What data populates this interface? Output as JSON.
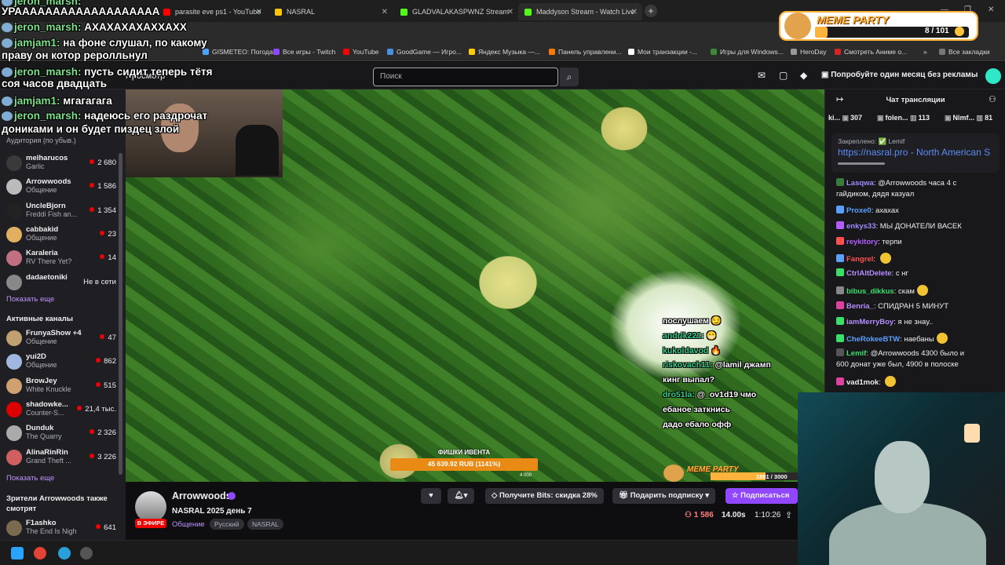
{
  "browser": {
    "tabs": [
      {
        "label": "parasite eve ps1 - YouTube",
        "color": "#ff0000"
      },
      {
        "label": "NASRAL",
        "color": "#ffc400"
      },
      {
        "label": "GLADVALAKASPWNZ Stream",
        "color": "#53fc18"
      },
      {
        "label": "Maddyson Stream - Watch Live",
        "color": "#53fc18"
      }
    ],
    "new_tab": "+",
    "bookmarks": [
      {
        "label": "Все игры - Twitch",
        "color": "#9147ff"
      },
      {
        "label": "YouTube",
        "color": "#ff0000"
      },
      {
        "label": "GoodGame — Игро...",
        "color": "#4a90e2"
      },
      {
        "label": "Яндекс Музыка —...",
        "color": "#ffcc00"
      },
      {
        "label": "Панель управлени...",
        "color": "#ff7a00"
      },
      {
        "label": "Мои транзакции -...",
        "color": "#ffffff"
      },
      {
        "label": "Игры для Windows...",
        "color": "#3a8a3a"
      },
      {
        "label": "HeroDay",
        "color": "#999999"
      },
      {
        "label": "Смотреть Аниме о...",
        "color": "#d62424"
      }
    ],
    "bookmarks_all": "Все закладки",
    "partial_bookmark": "GISMETEO: Погода...",
    "partial_bookmark2": "Ми...Ру почта,..."
  },
  "twitch": {
    "search_placeholder": "Поиск",
    "browse": "Просмотр",
    "promo": "Попробуйте один месяц без рекламы"
  },
  "sidebar": {
    "audience_header": "Аудитория (по убыв.)",
    "audience": [
      {
        "name": "melharucos",
        "sub": "Garlic",
        "count": "2 680",
        "color": "#3a3a3a"
      },
      {
        "name": "Arrowwoods",
        "sub": "Общение",
        "count": "1 586",
        "color": "#bbbbbb"
      },
      {
        "name": "UncleBjorn",
        "sub": "Freddi Fish an...",
        "count": "1 354",
        "color": "#222222"
      },
      {
        "name": "cabbakid",
        "sub": "Общение",
        "count": "23",
        "color": "#e0b060"
      },
      {
        "name": "Karaleria",
        "sub": "RV There Yet?",
        "count": "14",
        "color": "#c07080"
      },
      {
        "name": "dadaetoniki",
        "sub": "",
        "count": "Не в сети",
        "color": "#888888"
      }
    ],
    "show_more": "Показать еще",
    "active_header": "Активные каналы",
    "active": [
      {
        "name": "FrunyaShow +4",
        "sub": "Общение",
        "count": "47",
        "color": "#c0a070"
      },
      {
        "name": "yui2D",
        "sub": "Общение",
        "count": "862",
        "color": "#a0b8e0"
      },
      {
        "name": "BrowJey",
        "sub": "White Knuckle",
        "count": "515",
        "color": "#d0a070"
      },
      {
        "name": "shadowke...",
        "sub": "Counter-S...",
        "count": "21,4 тыс.",
        "color": "#dd0000"
      },
      {
        "name": "Dunduk",
        "sub": "The Quarry",
        "count": "2 326",
        "color": "#aaaaaa"
      },
      {
        "name": "AlinaRinRin",
        "sub": "Grand Theft ...",
        "count": "3 226",
        "color": "#d06060"
      }
    ],
    "show_more2": "Показать еще",
    "also_header": "Зрители Arrowwoods также смотрят",
    "also": [
      {
        "name": "F1ashko",
        "sub": "The End Is Nigh",
        "count": "641",
        "color": "#7a6a50"
      }
    ]
  },
  "overlay_chat": [
    {
      "user": "jeron_marsh:",
      "text": ""
    },
    {
      "user": "",
      "text": "УРААААААААААААААААААА"
    },
    {
      "user": "jeron_marsh:",
      "text": "АХАХАХАХАХХАХХ"
    },
    {
      "user": "jamjam1:",
      "text": "на фоне слушал, по какому"
    },
    {
      "user": "",
      "text": "праву он котор реролльнул"
    },
    {
      "user": "jeron_marsh:",
      "text": "пусть сидит теперь тётя"
    },
    {
      "user": "",
      "text": "соя часов двадцать"
    },
    {
      "user": "jamjam1:",
      "text": "мгагагага"
    },
    {
      "user": "jeron_marsh:",
      "text": "надеюсь его раздрочат"
    },
    {
      "user": "",
      "text": "дониками и он будет пиздец злой"
    }
  ],
  "ingame_chat": [
    {
      "user": "",
      "text": "послушаем 😏"
    },
    {
      "user": "andrik221:",
      "text": "😁"
    },
    {
      "user": "kukoldavod",
      "text": "🔥"
    },
    {
      "user": "riskovach11:",
      "text": "@lamil джамп"
    },
    {
      "user": "",
      "text": "кинг выпал?"
    },
    {
      "user": "dro51la:",
      "text": "@_ov1d19 чмо"
    },
    {
      "user": "",
      "text": "ебаное заткнись"
    },
    {
      "user": "",
      "text": "дадо ебало офф"
    }
  ],
  "event": {
    "label": "ФИШКИ ИВЕНТА",
    "value": "45 639.92 RUB (1141%)",
    "max": "4 000",
    "progress": 1.0
  },
  "meme_bottom": {
    "label": "MEME PARTY",
    "count": "1881 / 3000",
    "progress": 0.627
  },
  "meme_top": {
    "label": "MEME PARTY",
    "count": "8 / 101",
    "progress": 0.08
  },
  "stream": {
    "channel": "Arrowwoods",
    "live": "В ЭФИРЕ",
    "title": "NASRAL 2025 день 7",
    "category": "Общение",
    "tags": [
      "Русский",
      "NASRAL"
    ],
    "bits": "Получите Bits: скидка 28%",
    "gift": "Подарить подписку",
    "subscribe": "Подписаться",
    "viewers": "1 586",
    "sessions": "14.00s",
    "uptime": "1:10:26"
  },
  "chat": {
    "title": "Чат трансляции",
    "gifters": [
      {
        "name": "ki...",
        "count": "307"
      },
      {
        "name": "folen...",
        "count": "113"
      },
      {
        "name": "Nimf...",
        "count": "81"
      }
    ],
    "pinned_label": "Закреплено: ✅ Lemif",
    "pinned_link": "https://nasral.pro - North American S",
    "messages": [
      {
        "user": "Lasqwa",
        "color": "#9b8cff",
        "text": "@Arrowwoods часа 4 с"
      },
      {
        "user": "",
        "color": "",
        "text": "гайдиком, дядя казуал"
      },
      {
        "user": "Proxe0",
        "color": "#5aa0ff",
        "text": "ахахах"
      },
      {
        "user": "enkys33",
        "color": "#9b8cff",
        "text": "МЫ ДОНАТЕЛИ ВАСЕК"
      },
      {
        "user": "reykitory",
        "color": "#b35cff",
        "text": "терпи"
      },
      {
        "user": "Fangrel",
        "color": "#ff4f4f",
        "text": ""
      },
      {
        "user": "CtrlAltDelete",
        "color": "#b58cff",
        "text": "с нг"
      },
      {
        "user": "bibus_dikkus",
        "color": "#38e06a",
        "text": "скам"
      },
      {
        "user": "Benria_",
        "color": "#b58cff",
        "text": "СПИДРАН 5 МИНУТ"
      },
      {
        "user": "iamMerryBoy",
        "color": "#b58cff",
        "text": "я не знау.."
      },
      {
        "user": "CheRokeeBTW",
        "color": "#5aa0ff",
        "text": "наебаны"
      },
      {
        "user": "Lemif",
        "color": "#38e06a",
        "text": "@Arrowwoods 4300 было и"
      },
      {
        "user": "",
        "color": "",
        "text": "600 донат уже был, 4900 в полоске"
      },
      {
        "user": "vad1mok",
        "color": "#efeff1",
        "text": ""
      }
    ]
  }
}
